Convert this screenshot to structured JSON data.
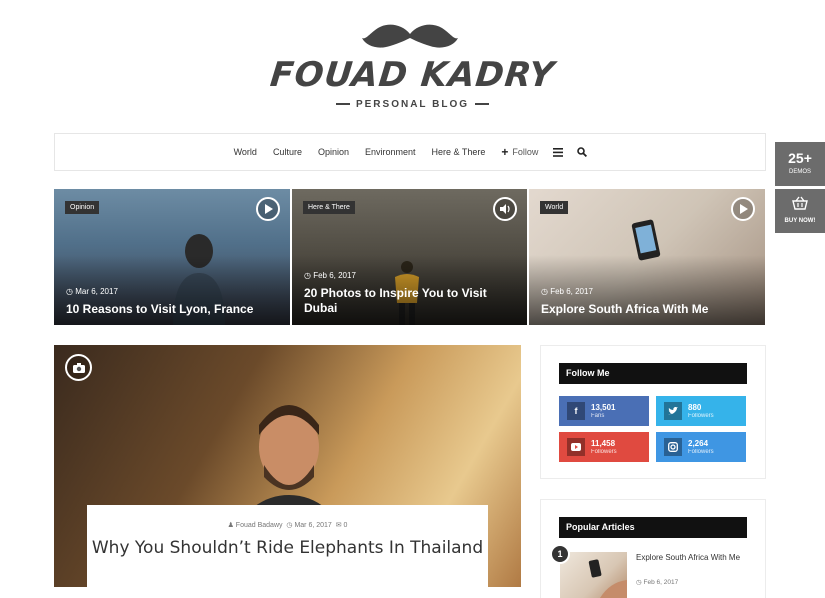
{
  "brand": {
    "title": "FOUAD KADRY",
    "subtitle": "PERSONAL BLOG"
  },
  "nav": {
    "items": [
      "World",
      "Culture",
      "Opinion",
      "Environment",
      "Here & There"
    ],
    "follow_label": "Follow",
    "icons": [
      "plus-icon",
      "menu-icon",
      "search-icon"
    ]
  },
  "side": {
    "demos_count": "25+",
    "demos_label": "DEMOS",
    "buy_label": "BUY NOW!"
  },
  "featured": [
    {
      "category": "Opinion",
      "date": "Mar 6, 2017",
      "title": "10 Reasons to Visit Lyon, France",
      "media_icon": "play-icon"
    },
    {
      "category": "Here & There",
      "date": "Feb 6, 2017",
      "title": "20 Photos to Inspire You to Visit Dubai",
      "media_icon": "audio-icon"
    },
    {
      "category": "World",
      "date": "Feb 6, 2017",
      "title": "Explore South Africa With Me",
      "media_icon": "play-icon"
    }
  ],
  "main_article": {
    "author": "Fouad Badawy",
    "date": "Mar 6, 2017",
    "comments": "0",
    "title": "Why You Shouldn’t Ride Elephants In Thailand",
    "media_icon": "camera-icon"
  },
  "follow_widget": {
    "title": "Follow Me",
    "networks": [
      {
        "name": "facebook",
        "count": "13,501",
        "label": "Fans",
        "color": "#4a6fb5"
      },
      {
        "name": "twitter",
        "count": "880",
        "label": "Followers",
        "color": "#35b3ea"
      },
      {
        "name": "youtube",
        "count": "11,458",
        "label": "Followers",
        "color": "#e04a40"
      },
      {
        "name": "instagram",
        "count": "2,264",
        "label": "Followers",
        "color": "#3f96e3"
      }
    ]
  },
  "popular_widget": {
    "title": "Popular Articles",
    "items": [
      {
        "rank": "1",
        "title": "Explore South Africa With Me",
        "date": "Feb 6, 2017"
      }
    ]
  }
}
